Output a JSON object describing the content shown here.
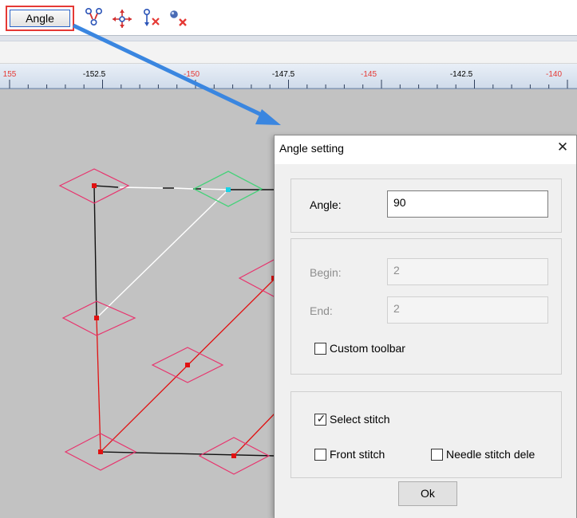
{
  "toolbar": {
    "angle_button_label": "Angle",
    "icons": [
      "stitch-merge-icon",
      "move-cross-icon",
      "delete-needle-icon",
      "delete-point-icon"
    ]
  },
  "ruler": {
    "labels": [
      {
        "text": "155",
        "color": "#e53935"
      },
      {
        "text": "-152.5",
        "color": "#000000"
      },
      {
        "text": "-150",
        "color": "#e53935"
      },
      {
        "text": "-147.5",
        "color": "#000000"
      },
      {
        "text": "-145",
        "color": "#e53935"
      },
      {
        "text": "-142.5",
        "color": "#000000"
      },
      {
        "text": "-140",
        "color": "#e53935"
      }
    ]
  },
  "dialog": {
    "title": "Angle setting",
    "close_label": "X",
    "angle_label": "Angle:",
    "angle_value": "90",
    "begin_label": "Begin:",
    "begin_value": "2",
    "end_label": "End:",
    "end_value": "2",
    "custom_toolbar_label": "Custom toolbar",
    "custom_toolbar_checked": false,
    "select_stitch_label": "Select stitch",
    "select_stitch_checked": true,
    "front_stitch_label": "Front stitch",
    "front_stitch_checked": false,
    "needle_stitch_label": "Needle stitch dele",
    "needle_stitch_checked": false,
    "ok_label": "Ok"
  },
  "colors": {
    "highlight_border": "#e53935",
    "arrow": "#3a86e0",
    "diamond": "#e8336d",
    "selected_diamond": "#46d27a",
    "stitch_red": "#e11111",
    "canvas": "#c2c2c2"
  }
}
